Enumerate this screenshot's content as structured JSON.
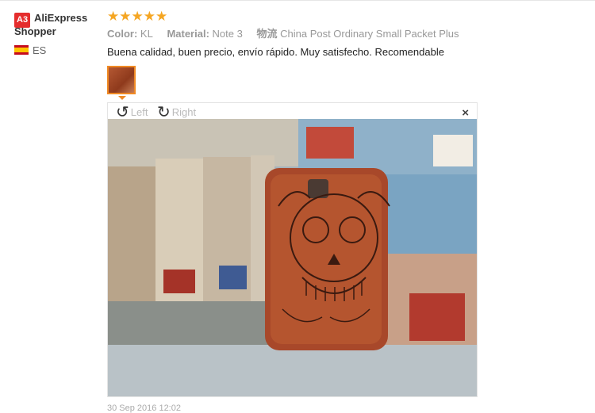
{
  "user": {
    "badge": "A3",
    "name": "AliExpress Shopper",
    "country": "ES"
  },
  "rating": {
    "stars": "★★★★★",
    "value": 5,
    "max": 5
  },
  "props": {
    "color_label": "Color:",
    "color_value": "KL",
    "material_label": "Material:",
    "material_value": "Note 3",
    "shipping_label": "物流",
    "shipping_value": "China Post Ordinary Small Packet Plus"
  },
  "review_text": "Buena calidad, buen precio, envío rápido. Muy satisfecho. Recomendable",
  "viewer": {
    "rotate_left": "Left",
    "rotate_right": "Right",
    "close": "×"
  },
  "footer": {
    "date": "30 Sep 2016 12:02"
  },
  "colors": {
    "star": "#f5a623",
    "badge": "#e52d2d",
    "thumb_border": "#f08a24",
    "wood": "#a8482a"
  }
}
